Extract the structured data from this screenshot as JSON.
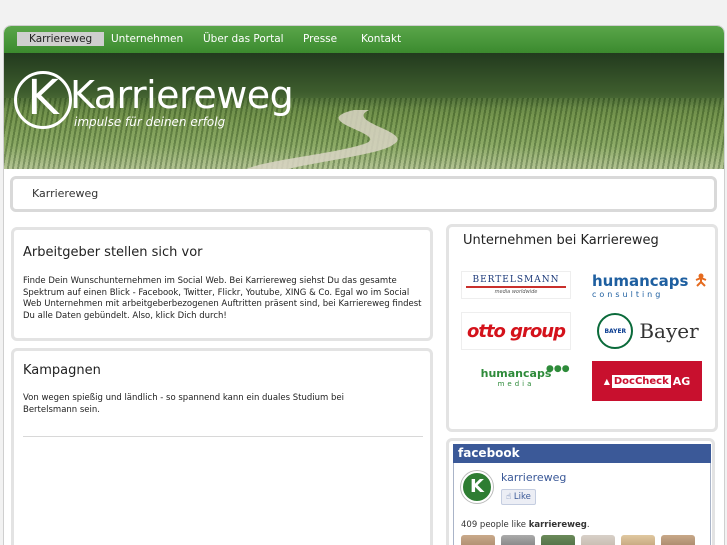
{
  "nav": {
    "items": [
      "Karriereweg",
      "Unternehmen",
      "Über das Portal",
      "Presse",
      "Kontakt"
    ]
  },
  "banner": {
    "logo_letter": "K",
    "site_name": "Karriereweg",
    "tagline": "impulse für deinen erfolg"
  },
  "breadcrumb": "Karriereweg",
  "employers": {
    "title": "Arbeitgeber stellen sich vor",
    "text": "Finde Dein Wunschunternehmen im Social Web. Bei Karriereweg siehst Du das gesamte Spektrum auf einen Blick - Facebook, Twitter, Flickr, Youtube, XING & Co. Egal wo im Social Web Unternehmen mit arbeitgeberbezogenen Auftritten präsent sind, bei Karriereweg findest Du alle Daten gebündelt. Also, klick Dich durch!"
  },
  "campaigns": {
    "title": "Kampagnen",
    "text": "Von wegen spießig und ländlich - so spannend kann ein duales Studium bei Bertelsmann sein."
  },
  "companies": {
    "title": "Unternehmen bei Karriereweg",
    "logos": {
      "bertelsmann": "BERTELSMANN",
      "bertelsmann_sub": "media worldwide",
      "humancaps": "humancaps",
      "humancaps_sub": "consulting",
      "otto": "otto group",
      "bayer_cross": "BAYER",
      "bayer": "Bayer",
      "humancaps_media": "humancaps",
      "humancaps_media_sub": "media",
      "doccheck": "DocCheck",
      "doccheck_ag": "AG"
    }
  },
  "facebook": {
    "header": "facebook",
    "page_name": "karriereweg",
    "avatar_letter": "K",
    "like_label": "Like",
    "count_text": "409 people like",
    "count_name": "karriereweg",
    "count_dot": "."
  },
  "colors": {
    "nav_green": "#4a9a3c",
    "fb_blue": "#3b5998",
    "otto_red": "#d4121b",
    "doccheck_red": "#c8102e"
  }
}
